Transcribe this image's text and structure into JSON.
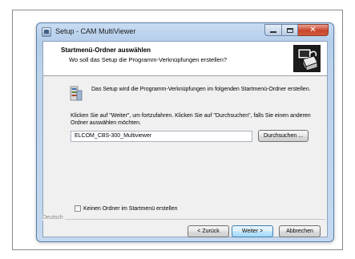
{
  "window": {
    "title": "Setup - CAM MultiViewer"
  },
  "header": {
    "title": "Startmenü-Ordner auswählen",
    "subtitle": "Wo soll das Setup die Programm-Verknüpfungen erstellen?"
  },
  "body": {
    "intro": "Das Setup wird die Programm-Verknüpfungen im folgenden Startmenü-Ordner erstellen.",
    "instructions": "Klicken Sie auf \"Weiter\", um fortzufahren. Klicken Sie auf \"Durchsuchen\", falls Sie einen anderen Ordner auswählen möchten.",
    "folder_value": "ELCOM_CBS-300_Multiviewer",
    "browse_label": "Durchsuchen ...",
    "no_folder_checkbox_label": "Keinen Ordner im Startmenü erstellen",
    "no_folder_checked": false
  },
  "footer": {
    "language": "Deutsch",
    "back_label": "< Zurück",
    "next_label": "Weiter >",
    "cancel_label": "Abbrechen"
  },
  "icons": {
    "app": "setup-app-icon",
    "logo": "setup-computer-box-icon",
    "folder": "startmenu-folder-icon"
  },
  "colors": {
    "window_frame": "#b9cfe8",
    "close_button": "#c8452c",
    "dialog_background": "#f0f0f0",
    "default_button_border": "#3c7fb1"
  }
}
